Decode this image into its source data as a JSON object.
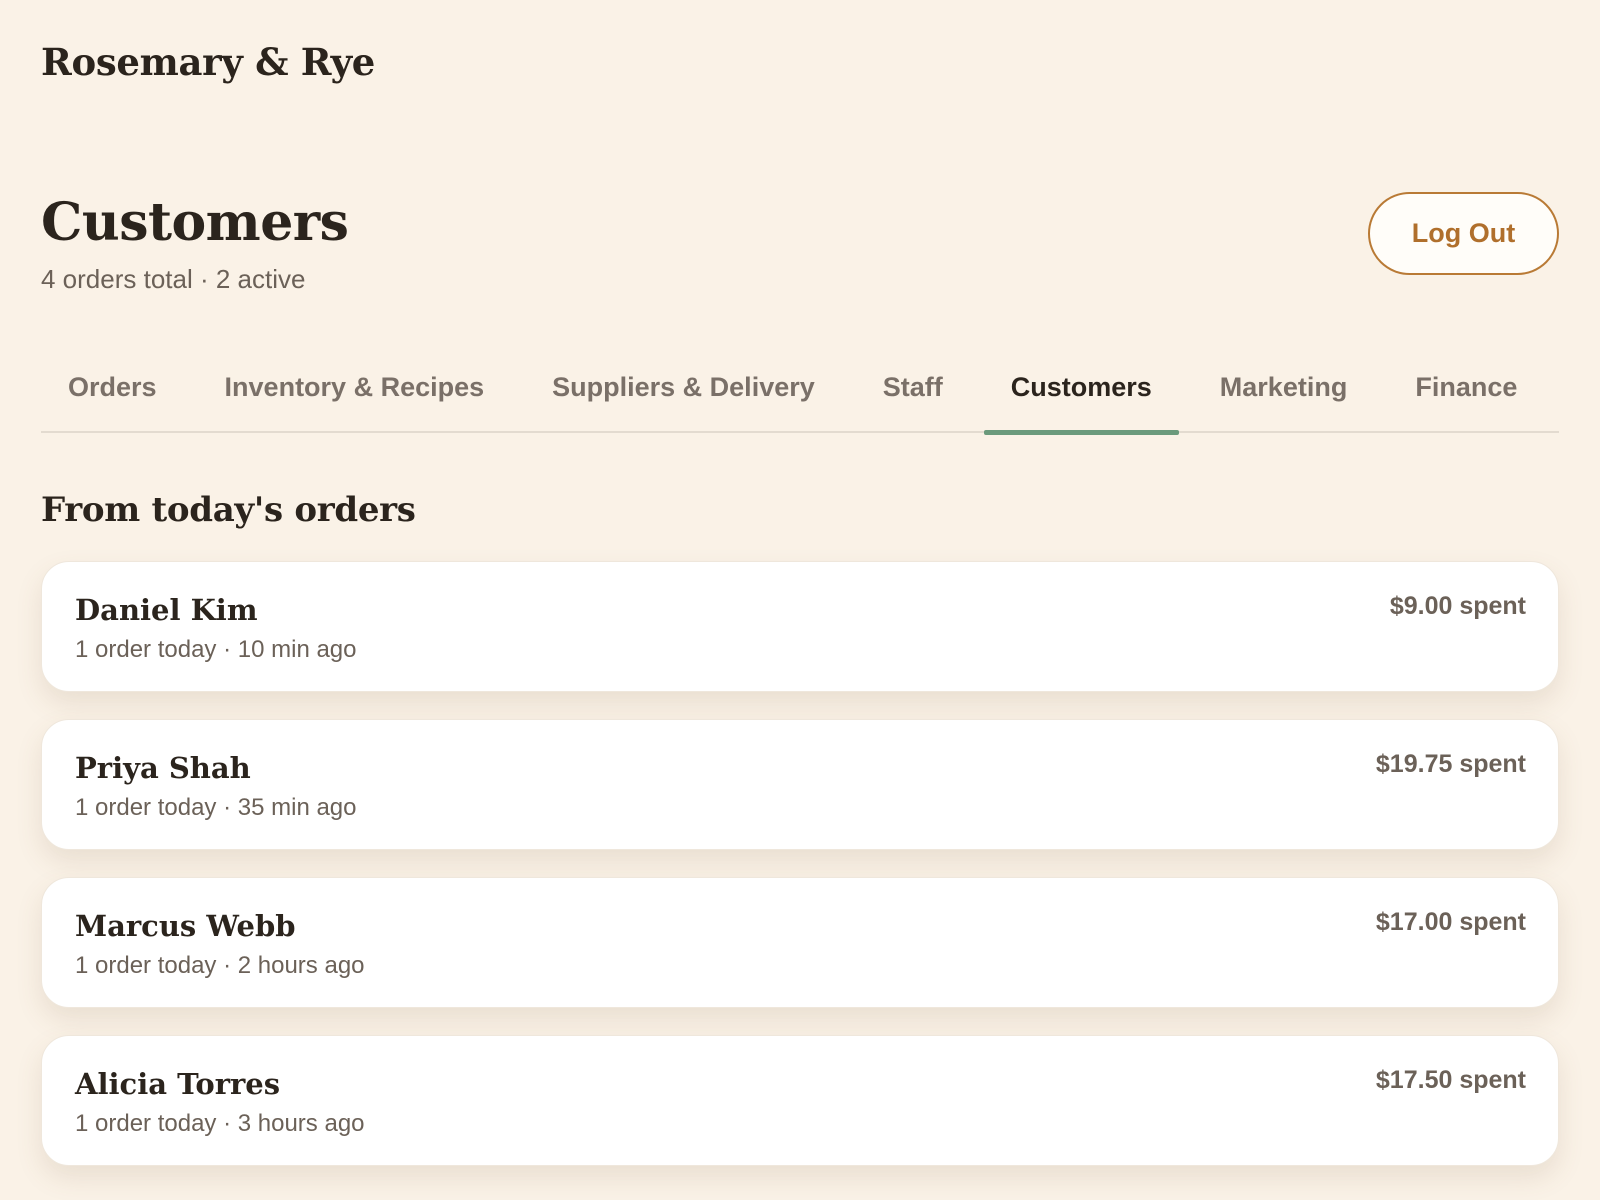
{
  "app": {
    "brand": "Rosemary & Rye"
  },
  "header": {
    "title": "Customers",
    "subtitle": "4 orders total · 2 active",
    "logout_label": "Log Out"
  },
  "tabs": [
    {
      "label": "Orders",
      "active": false
    },
    {
      "label": "Inventory & Recipes",
      "active": false
    },
    {
      "label": "Suppliers & Delivery",
      "active": false
    },
    {
      "label": "Staff",
      "active": false
    },
    {
      "label": "Customers",
      "active": true
    },
    {
      "label": "Marketing",
      "active": false
    },
    {
      "label": "Finance",
      "active": false
    }
  ],
  "section": {
    "title": "From today's orders"
  },
  "customers": [
    {
      "name": "Daniel Kim",
      "meta": "1 order today · 10 min ago",
      "spent": "$9.00 spent"
    },
    {
      "name": "Priya Shah",
      "meta": "1 order today · 35 min ago",
      "spent": "$19.75 spent"
    },
    {
      "name": "Marcus Webb",
      "meta": "1 order today · 2 hours ago",
      "spent": "$17.00 spent"
    },
    {
      "name": "Alicia Torres",
      "meta": "1 order today · 3 hours ago",
      "spent": "$17.50 spent"
    }
  ],
  "colors": {
    "background": "#faf2e7",
    "accent": "#b06f2c",
    "active_tab_underline": "#6b9a7c"
  }
}
